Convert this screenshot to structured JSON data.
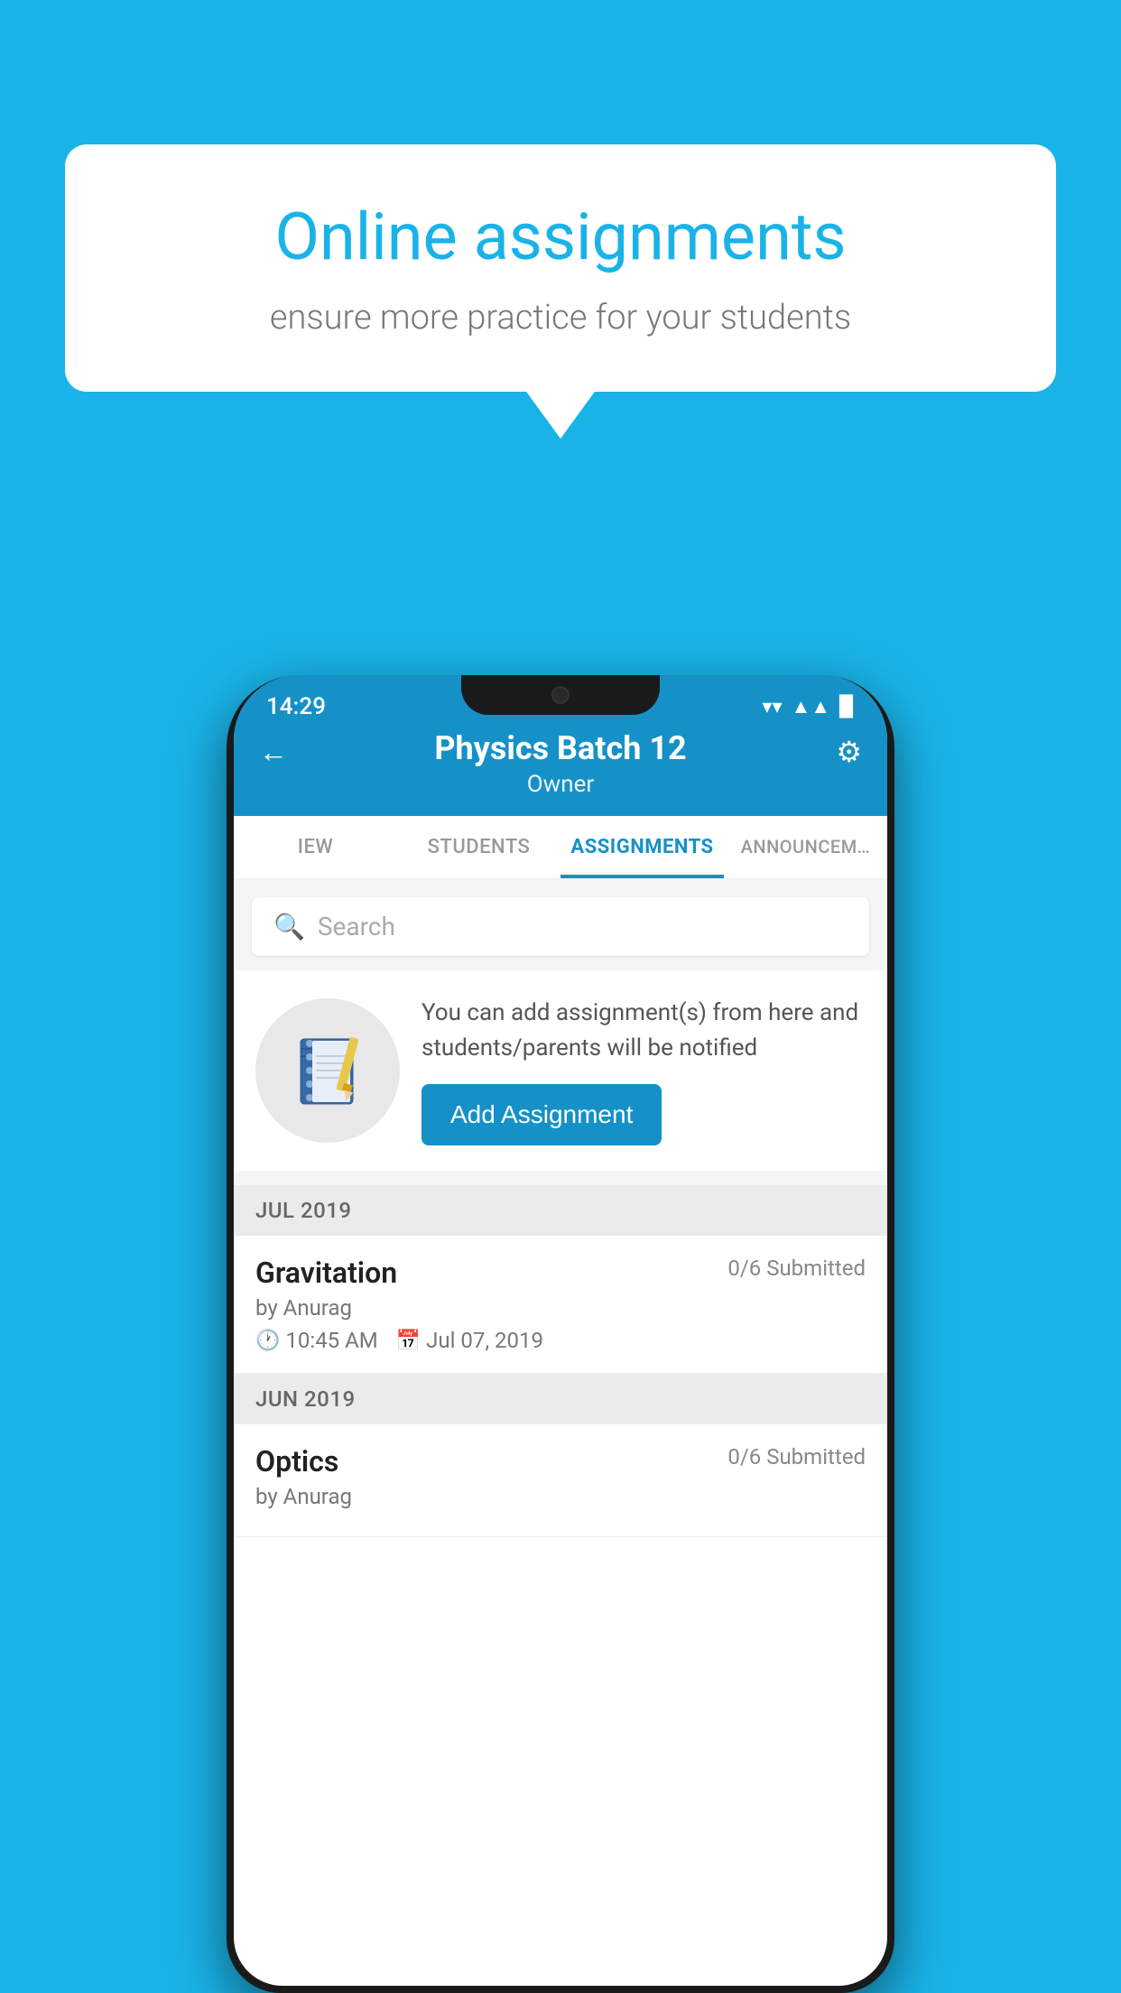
{
  "background_color": "#1ab3e8",
  "speech_bubble": {
    "title": "Online assignments",
    "subtitle": "ensure more practice for your students"
  },
  "status_bar": {
    "time": "14:29",
    "wifi": "▲",
    "signal": "▲",
    "battery": "▉"
  },
  "header": {
    "title": "Physics Batch 12",
    "subtitle": "Owner"
  },
  "tabs": [
    {
      "label": "IEW",
      "active": false
    },
    {
      "label": "STUDENTS",
      "active": false
    },
    {
      "label": "ASSIGNMENTS",
      "active": true
    },
    {
      "label": "ANNOUNCEM…",
      "active": false
    }
  ],
  "search": {
    "placeholder": "Search"
  },
  "promo": {
    "text": "You can add assignment(s) from here and students/parents will be notified",
    "button_label": "Add Assignment"
  },
  "sections": [
    {
      "label": "JUL 2019",
      "assignments": [
        {
          "name": "Gravitation",
          "submitted": "0/6 Submitted",
          "author": "by Anurag",
          "time": "10:45 AM",
          "date": "Jul 07, 2019"
        }
      ]
    },
    {
      "label": "JUN 2019",
      "assignments": [
        {
          "name": "Optics",
          "submitted": "0/6 Submitted",
          "author": "by Anurag",
          "time": "",
          "date": ""
        }
      ]
    }
  ],
  "icons": {
    "back": "←",
    "settings": "⚙",
    "search": "🔍",
    "clock": "🕐",
    "calendar": "📅",
    "notebook": "📓"
  }
}
